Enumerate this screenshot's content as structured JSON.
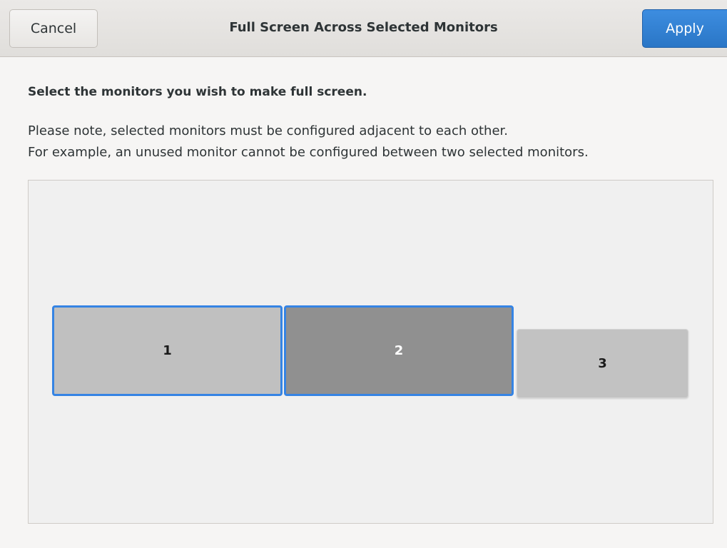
{
  "header": {
    "title": "Full Screen Across Selected Monitors",
    "cancel_label": "Cancel",
    "apply_label": "Apply"
  },
  "content": {
    "heading": "Select the monitors you wish to make full screen.",
    "note_line1": "Please note, selected monitors must be configured adjacent to each other.",
    "note_line2": "For example, an unused monitor cannot be configured between two selected monitors."
  },
  "monitors": [
    {
      "label": "1",
      "selected": true
    },
    {
      "label": "2",
      "selected": true
    },
    {
      "label": "3",
      "selected": false
    }
  ],
  "colors": {
    "accent": "#3584e4",
    "apply_button": "#2a76c6",
    "monitor_bg": "#c0c0c0",
    "monitor_active_bg": "#909090"
  }
}
